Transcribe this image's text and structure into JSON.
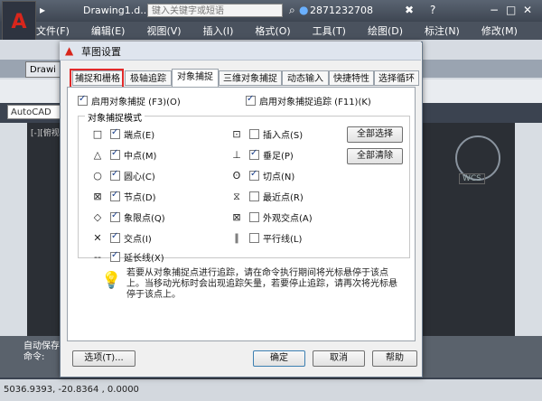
{
  "titlebar": {
    "doc_title": "Drawing1.d...",
    "search_placeholder": "键入关键字或短语",
    "account": "2871232708"
  },
  "menubar": [
    "文件(F)",
    "编辑(E)",
    "视图(V)",
    "插入(I)",
    "格式(O)",
    "工具(T)",
    "绘图(D)",
    "标注(N)",
    "修改(M)"
  ],
  "ribbon": {
    "drawing_tab": "Drawi",
    "autocad_field": "AutoCAD"
  },
  "dialog": {
    "title": "草图设置",
    "tabs": [
      "捕捉和栅格",
      "极轴追踪",
      "对象捕捉",
      "三维对象捕捉",
      "动态输入",
      "快捷特性",
      "选择循环"
    ],
    "active_tab": "对象捕捉",
    "enable_snap": "启用对象捕捉 (F3)(O)",
    "enable_track": "启用对象捕捉追踪 (F11)(K)",
    "group_label": "对象捕捉模式",
    "left_items": [
      {
        "symbol": "□",
        "label": "端点(E)",
        "checked": true
      },
      {
        "symbol": "△",
        "label": "中点(M)",
        "checked": true
      },
      {
        "symbol": "○",
        "label": "圆心(C)",
        "checked": true
      },
      {
        "symbol": "⊠",
        "label": "节点(D)",
        "checked": true
      },
      {
        "symbol": "◇",
        "label": "象限点(Q)",
        "checked": true
      },
      {
        "symbol": "✕",
        "label": "交点(I)",
        "checked": true
      },
      {
        "symbol": "--",
        "label": "延长线(X)",
        "checked": true
      }
    ],
    "right_items": [
      {
        "symbol": "⊡",
        "label": "插入点(S)",
        "checked": false
      },
      {
        "symbol": "⊥",
        "label": "垂足(P)",
        "checked": true
      },
      {
        "symbol": "ʘ",
        "label": "切点(N)",
        "checked": true
      },
      {
        "symbol": "⧖",
        "label": "最近点(R)",
        "checked": false
      },
      {
        "symbol": "⊠",
        "label": "外观交点(A)",
        "checked": false
      },
      {
        "symbol": "∥",
        "label": "平行线(L)",
        "checked": false
      }
    ],
    "select_all": "全部选择",
    "clear_all": "全部清除",
    "tip": "若要从对象捕捉点进行追踪，请在命令执行期间将光标悬停于该点上。当移动光标时会出现追踪矢量，若要停止追踪，请再次将光标悬停于该点上。",
    "options_btn": "选项(T)...",
    "ok_btn": "确定",
    "cancel_btn": "取消",
    "help_btn": "帮助"
  },
  "command": {
    "line1": "自动保存",
    "line2": "命令:"
  },
  "status": {
    "coords": "5036.9393,  -20.8364 , 0.0000"
  },
  "canvas": {
    "viewport_label": "[-][俯视]",
    "wcs": "WCS"
  }
}
